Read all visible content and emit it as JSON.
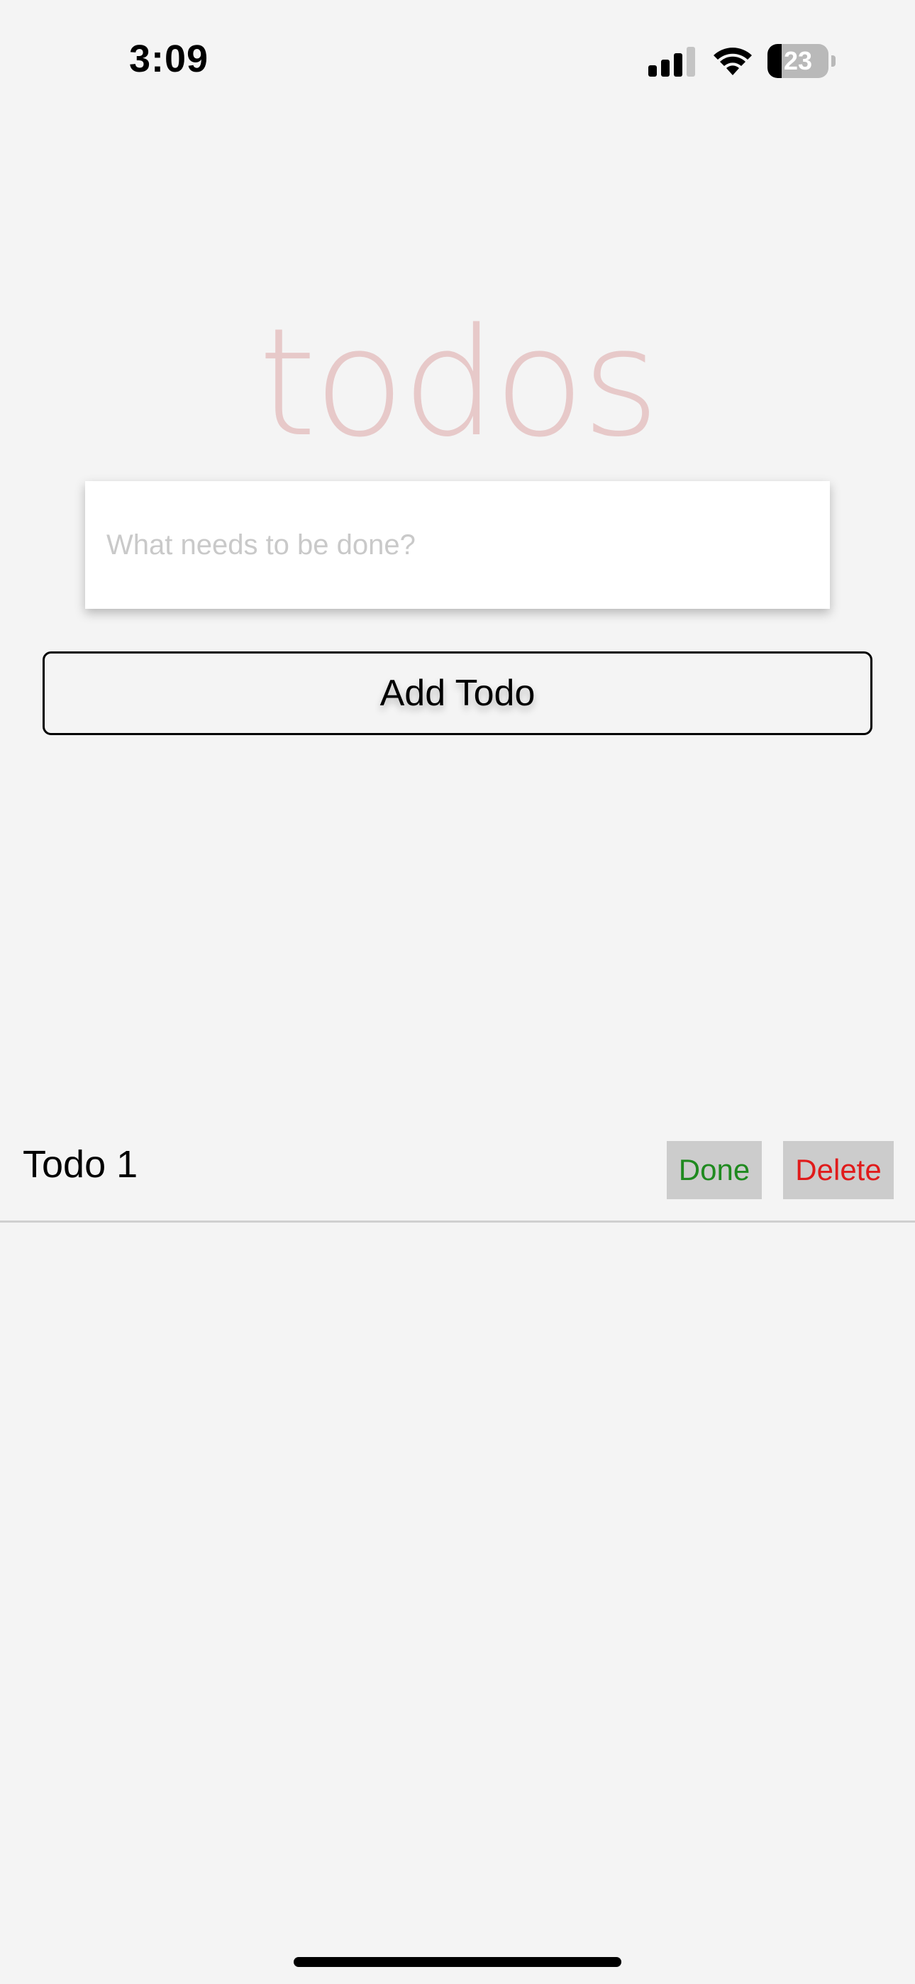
{
  "status_bar": {
    "time": "3:09",
    "battery_level": "23",
    "battery_fraction": 0.23,
    "signal_icon": "cellular-signal-icon",
    "wifi_icon": "wifi-icon",
    "battery_icon": "battery-icon"
  },
  "app": {
    "title": "todos",
    "input_placeholder": "What needs to be done?",
    "input_value": "",
    "add_button_label": "Add Todo"
  },
  "todos": [
    {
      "text": "Todo 1",
      "done_label": "Done",
      "delete_label": "Delete"
    }
  ],
  "colors": {
    "background": "#f4f4f4",
    "title": "#e7c9c9",
    "done": "#1f8a1f",
    "delete": "#e01b1b",
    "action_button_bg": "#cccccc"
  }
}
